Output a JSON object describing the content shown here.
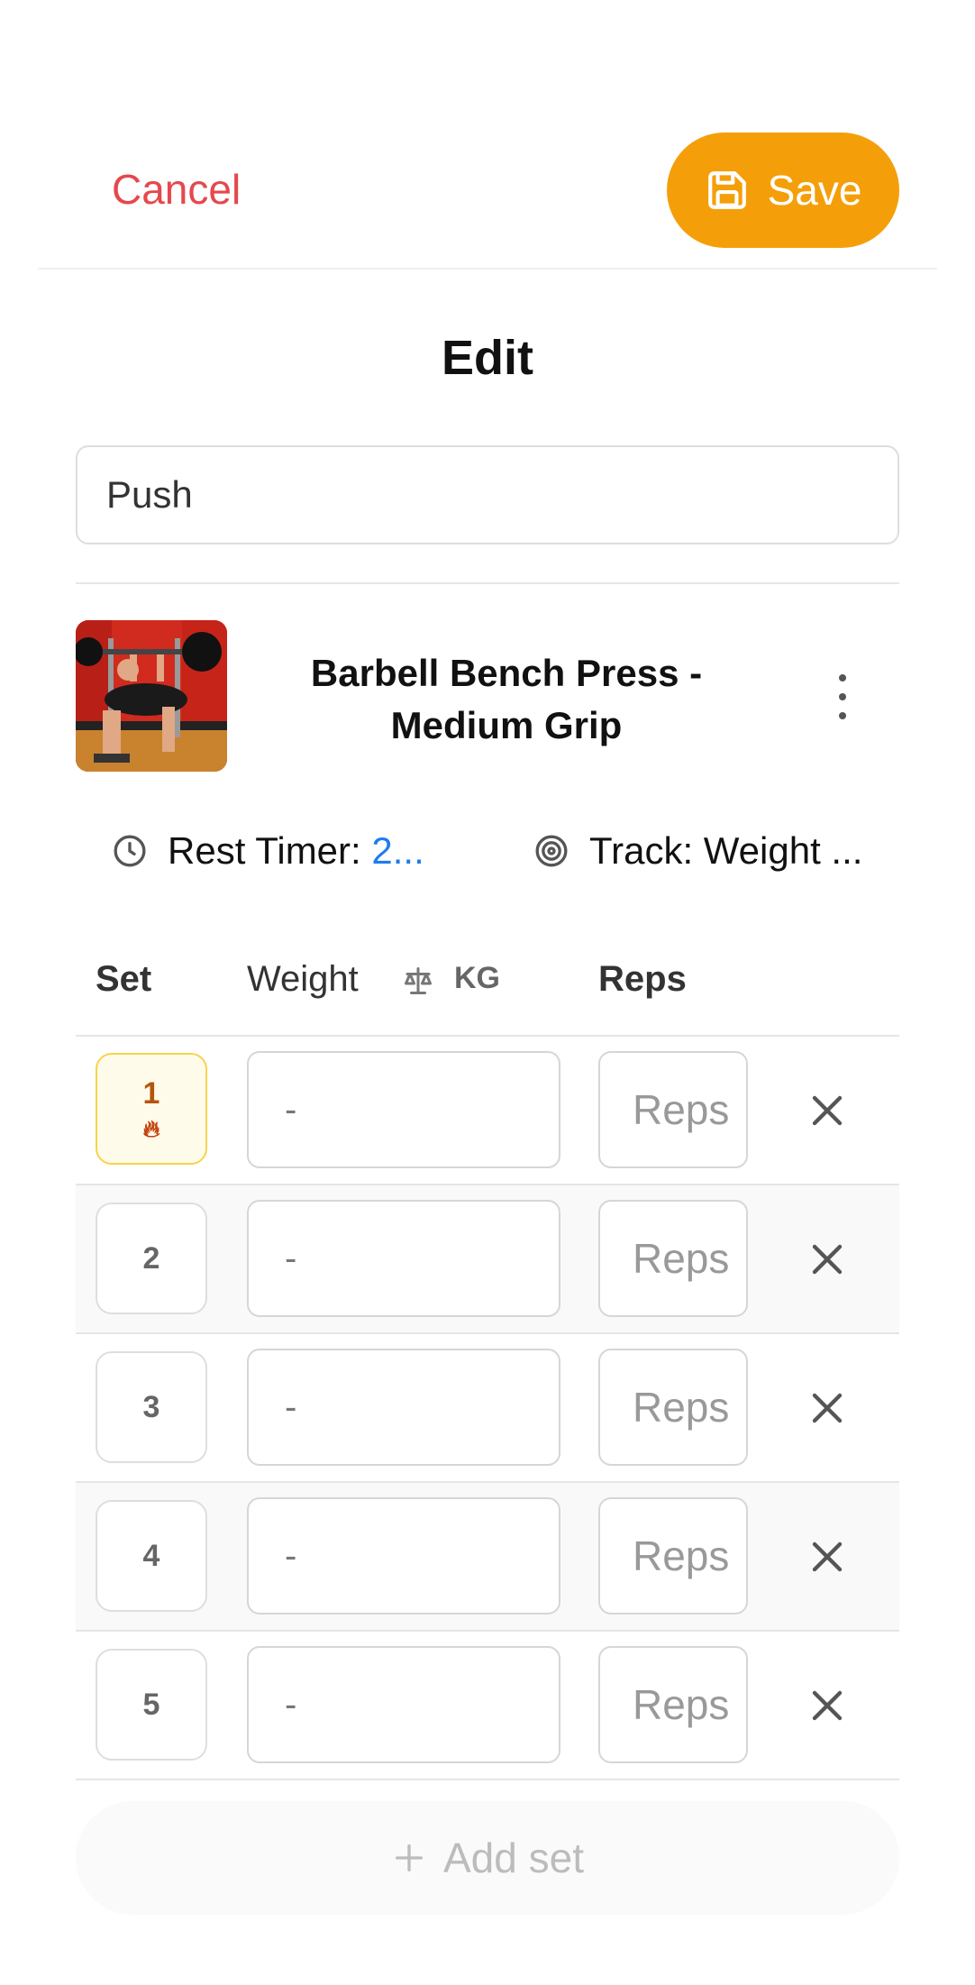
{
  "header": {
    "cancel_label": "Cancel",
    "save_label": "Save",
    "save_color": "#f49f0a",
    "cancel_color": "#e5484d"
  },
  "page": {
    "title": "Edit"
  },
  "routine": {
    "name_value": "Push"
  },
  "exercise": {
    "name": "Barbell Bench Press - Medium Grip",
    "rest_timer_label": "Rest Timer: ",
    "rest_timer_value": "2...",
    "track_label": "Track: Weight ..."
  },
  "table": {
    "col_set": "Set",
    "col_weight": "Weight",
    "weight_unit": "KG",
    "col_reps": "Reps",
    "rows": [
      {
        "set": "1",
        "weight": "-",
        "reps_placeholder": "Reps",
        "warmup": true
      },
      {
        "set": "2",
        "weight": "-",
        "reps_placeholder": "Reps",
        "warmup": false
      },
      {
        "set": "3",
        "weight": "-",
        "reps_placeholder": "Reps",
        "warmup": false
      },
      {
        "set": "4",
        "weight": "-",
        "reps_placeholder": "Reps",
        "warmup": false
      },
      {
        "set": "5",
        "weight": "-",
        "reps_placeholder": "Reps",
        "warmup": false
      }
    ]
  },
  "actions": {
    "add_set_label": "Add set"
  },
  "icons": {
    "save": "save-icon",
    "more": "more-vertical-icon",
    "clock": "clock-icon",
    "target": "target-icon",
    "scale": "scale-icon",
    "flame": "flame-icon",
    "close": "close-icon",
    "plus": "plus-icon"
  }
}
